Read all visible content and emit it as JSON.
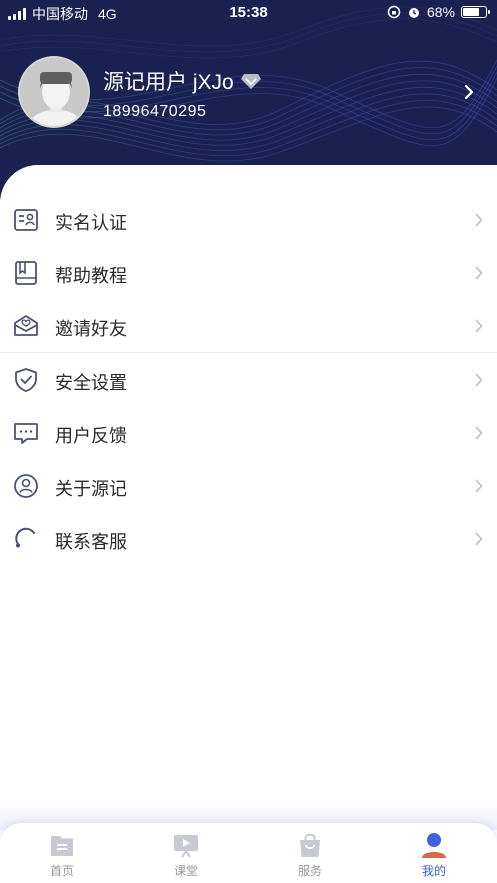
{
  "status_bar": {
    "carrier": "中国移动",
    "network": "4G",
    "time": "15:38",
    "battery": "68%",
    "battery_level": 0.68
  },
  "profile": {
    "username": "源记用户 jXJo",
    "phone": "18996470295",
    "badge_icon": "diamond-icon",
    "arrow_icon": "chevron-right-icon"
  },
  "menu": {
    "items": [
      {
        "label": "实名认证",
        "icon": "id-card-icon"
      },
      {
        "label": "帮助教程",
        "icon": "book-icon"
      },
      {
        "label": "邀请好友",
        "icon": "mail-icon"
      },
      {
        "label": "安全设置",
        "icon": "shield-icon"
      },
      {
        "label": "用户反馈",
        "icon": "message-icon"
      },
      {
        "label": "关于源记",
        "icon": "user-circle-icon"
      },
      {
        "label": "联系客服",
        "icon": "headset-icon"
      }
    ]
  },
  "tabbar": {
    "tabs": [
      {
        "label": "首页",
        "icon": "home-icon"
      },
      {
        "label": "课堂",
        "icon": "classroom-icon"
      },
      {
        "label": "服务",
        "icon": "bag-icon"
      },
      {
        "label": "我的",
        "icon": "profile-icon",
        "active": true
      }
    ]
  },
  "colors": {
    "header_bg": "#1b2150",
    "accent": "#3d5bd8",
    "icon": "#4a5272",
    "active_icon_head": "#3f62e0",
    "active_icon_body": "#d9684a"
  }
}
